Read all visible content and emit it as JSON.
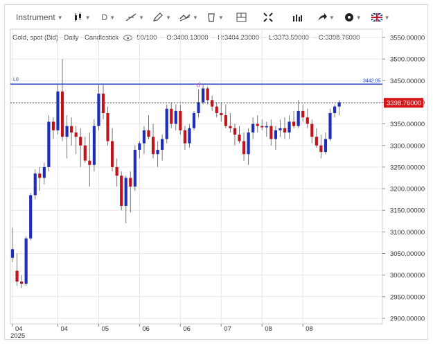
{
  "toolbar": {
    "instrument_label": "Instrument",
    "period_label": "D",
    "items": [
      "bar-type-icon",
      "line-tool-icon",
      "pencil-icon",
      "multi-line-icon",
      "delete-icon",
      "layout-icon",
      "fullscreen-icon",
      "volume-bars-icon",
      "arrow-icon",
      "objects-icon",
      "language-flag-icon"
    ]
  },
  "info": {
    "symbol": "Gold, spot (Bid) - Daily - Candlestick",
    "quality": "90/100",
    "open": "O:3400.13000",
    "high": "H:3404.23000",
    "low": "L:3373.59000",
    "close": "C:3398.76000"
  },
  "price_line": {
    "label": "L0",
    "value_text": "3442.05",
    "value": 3442.05,
    "color": "#1f3fbf"
  },
  "last_price": {
    "text": "3398.76000",
    "value": 3398.76,
    "color": "#d4161c"
  },
  "marker_text": "d",
  "colors": {
    "up": "#1d2fb8",
    "down": "#c0141c",
    "wick": "#777777",
    "grid": "#e6e6e6"
  },
  "chart_data": {
    "type": "candlestick",
    "ylim": [
      2885,
      3560
    ],
    "y_ticks": [
      "3550.00000",
      "3500.00000",
      "3450.00000",
      "3400.00000",
      "3350.00000",
      "3300.00000",
      "3250.00000",
      "3200.00000",
      "3150.00000",
      "3100.00000",
      "3050.00000",
      "3000.00000",
      "2950.00000",
      "2900.00000"
    ],
    "y_tick_values": [
      3550,
      3500,
      3450,
      3400,
      3350,
      3300,
      3250,
      3200,
      3150,
      3100,
      3050,
      3000,
      2950,
      2900
    ],
    "x_ticks": [
      {
        "label": "04",
        "index": 0,
        "sub": "2025"
      },
      {
        "label": "04",
        "index": 10
      },
      {
        "label": "05",
        "index": 19
      },
      {
        "label": "06",
        "index": 28
      },
      {
        "label": "06",
        "index": 37
      },
      {
        "label": "07",
        "index": 46
      },
      {
        "label": "08",
        "index": 55
      },
      {
        "label": "08",
        "index": 64
      }
    ],
    "candles": [
      [
        3040,
        3110,
        3030,
        3060
      ],
      [
        3010,
        3050,
        2975,
        2985
      ],
      [
        2985,
        3000,
        2970,
        2980
      ],
      [
        2980,
        3090,
        2975,
        3085
      ],
      [
        3085,
        3190,
        3080,
        3185
      ],
      [
        3185,
        3245,
        3175,
        3235
      ],
      [
        3235,
        3250,
        3195,
        3225
      ],
      [
        3225,
        3260,
        3210,
        3250
      ],
      [
        3250,
        3370,
        3240,
        3355
      ],
      [
        3355,
        3365,
        3315,
        3335
      ],
      [
        3335,
        3440,
        3325,
        3425
      ],
      [
        3425,
        3500,
        3310,
        3320
      ],
      [
        3320,
        3370,
        3270,
        3345
      ],
      [
        3345,
        3365,
        3300,
        3330
      ],
      [
        3330,
        3345,
        3280,
        3320
      ],
      [
        3320,
        3340,
        3250,
        3300
      ],
      [
        3300,
        3320,
        3260,
        3265
      ],
      [
        3265,
        3330,
        3205,
        3255
      ],
      [
        3255,
        3360,
        3240,
        3345
      ],
      [
        3345,
        3440,
        3335,
        3420
      ],
      [
        3420,
        3440,
        3360,
        3375
      ],
      [
        3375,
        3390,
        3300,
        3310
      ],
      [
        3310,
        3340,
        3240,
        3250
      ],
      [
        3250,
        3270,
        3205,
        3230
      ],
      [
        3230,
        3240,
        3150,
        3160
      ],
      [
        3160,
        3230,
        3120,
        3225
      ],
      [
        3225,
        3240,
        3145,
        3205
      ],
      [
        3205,
        3300,
        3195,
        3290
      ],
      [
        3290,
        3310,
        3270,
        3305
      ],
      [
        3305,
        3345,
        3280,
        3335
      ],
      [
        3335,
        3370,
        3315,
        3320
      ],
      [
        3320,
        3350,
        3270,
        3280
      ],
      [
        3280,
        3310,
        3250,
        3290
      ],
      [
        3290,
        3325,
        3265,
        3315
      ],
      [
        3315,
        3395,
        3305,
        3385
      ],
      [
        3385,
        3400,
        3340,
        3350
      ],
      [
        3350,
        3395,
        3335,
        3380
      ],
      [
        3380,
        3395,
        3325,
        3335
      ],
      [
        3335,
        3345,
        3290,
        3305
      ],
      [
        3305,
        3350,
        3295,
        3340
      ],
      [
        3340,
        3380,
        3335,
        3375
      ],
      [
        3375,
        3430,
        3365,
        3400
      ],
      [
        3400,
        3440,
        3395,
        3432
      ],
      [
        3432,
        3436,
        3395,
        3405
      ],
      [
        3405,
        3415,
        3380,
        3390
      ],
      [
        3390,
        3400,
        3365,
        3375
      ],
      [
        3375,
        3400,
        3355,
        3370
      ],
      [
        3370,
        3395,
        3340,
        3345
      ],
      [
        3345,
        3375,
        3330,
        3340
      ],
      [
        3340,
        3350,
        3300,
        3325
      ],
      [
        3325,
        3345,
        3305,
        3310
      ],
      [
        3310,
        3330,
        3265,
        3280
      ],
      [
        3280,
        3340,
        3255,
        3330
      ],
      [
        3330,
        3365,
        3315,
        3350
      ],
      [
        3350,
        3370,
        3330,
        3345
      ],
      [
        3345,
        3360,
        3335,
        3342
      ],
      [
        3342,
        3355,
        3320,
        3345
      ],
      [
        3345,
        3360,
        3300,
        3315
      ],
      [
        3315,
        3345,
        3290,
        3335
      ],
      [
        3335,
        3360,
        3320,
        3340
      ],
      [
        3340,
        3365,
        3315,
        3330
      ],
      [
        3330,
        3370,
        3315,
        3355
      ],
      [
        3355,
        3380,
        3340,
        3345
      ],
      [
        3345,
        3405,
        3340,
        3380
      ],
      [
        3380,
        3395,
        3355,
        3365
      ],
      [
        3365,
        3385,
        3340,
        3350
      ],
      [
        3350,
        3360,
        3305,
        3320
      ],
      [
        3320,
        3340,
        3295,
        3300
      ],
      [
        3300,
        3325,
        3270,
        3285
      ],
      [
        3285,
        3330,
        3280,
        3315
      ],
      [
        3315,
        3385,
        3310,
        3375
      ],
      [
        3375,
        3395,
        3365,
        3390
      ],
      [
        3390,
        3405,
        3370,
        3400
      ]
    ]
  }
}
